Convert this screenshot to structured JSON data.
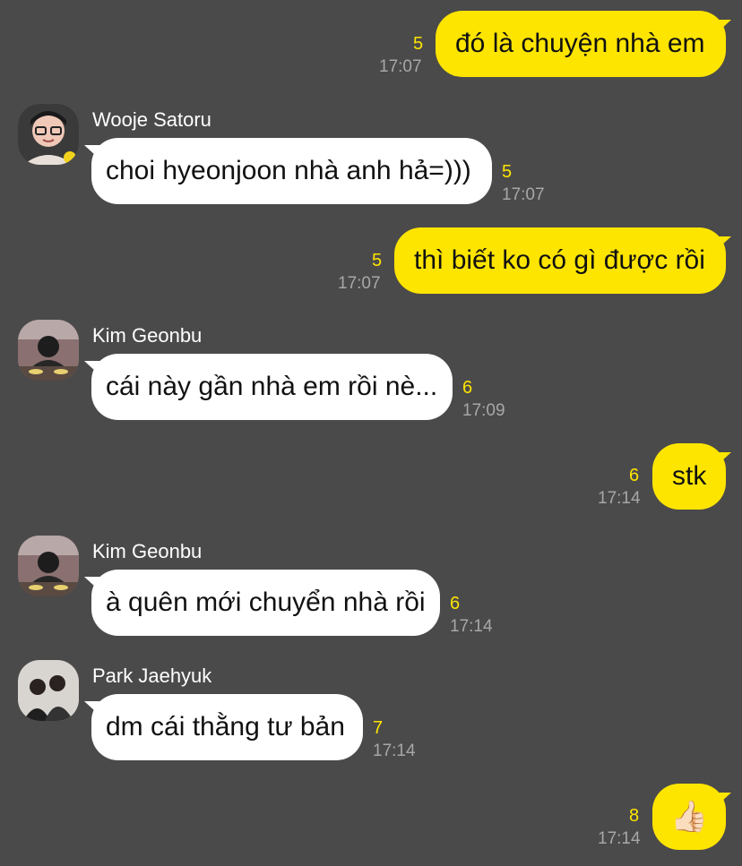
{
  "messages": [
    {
      "id": 1,
      "direction": "out",
      "text": "đó là chuyện nhà em",
      "unread": "5",
      "time": "17:07"
    },
    {
      "id": 2,
      "direction": "in",
      "sender": "Wooje Satoru",
      "avatar_icon": "person-glasses-avatar-icon",
      "text": "choi hyeonjoon nhà anh hả=)))",
      "unread": "5",
      "time": "17:07"
    },
    {
      "id": 3,
      "direction": "out",
      "text": "thì biết ko có gì được rồi",
      "unread": "5",
      "time": "17:07"
    },
    {
      "id": 4,
      "direction": "in",
      "sender": "Kim Geonbu",
      "avatar_icon": "person-eating-avatar-icon",
      "text": "cái này gần nhà em rồi nè...",
      "unread": "6",
      "time": "17:09"
    },
    {
      "id": 5,
      "direction": "out",
      "text": "stk",
      "unread": "6",
      "time": "17:14"
    },
    {
      "id": 6,
      "direction": "in",
      "sender": "Kim Geonbu",
      "avatar_icon": "person-eating-avatar-icon",
      "text": "à quên mới chuyển nhà rồi",
      "unread": "6",
      "time": "17:14"
    },
    {
      "id": 7,
      "direction": "in",
      "sender": "Park Jaehyuk",
      "avatar_icon": "two-people-avatar-icon",
      "text": "dm cái thằng tư bản",
      "unread": "7",
      "time": "17:14"
    },
    {
      "id": 8,
      "direction": "out",
      "text": "👍🏻",
      "unread": "8",
      "time": "17:14"
    }
  ],
  "colors": {
    "background": "#4b4a4a",
    "outgoing_bubble": "#fee500",
    "incoming_bubble": "#ffffff",
    "unread_count": "#fee500",
    "timestamp": "#a8a7a7"
  }
}
